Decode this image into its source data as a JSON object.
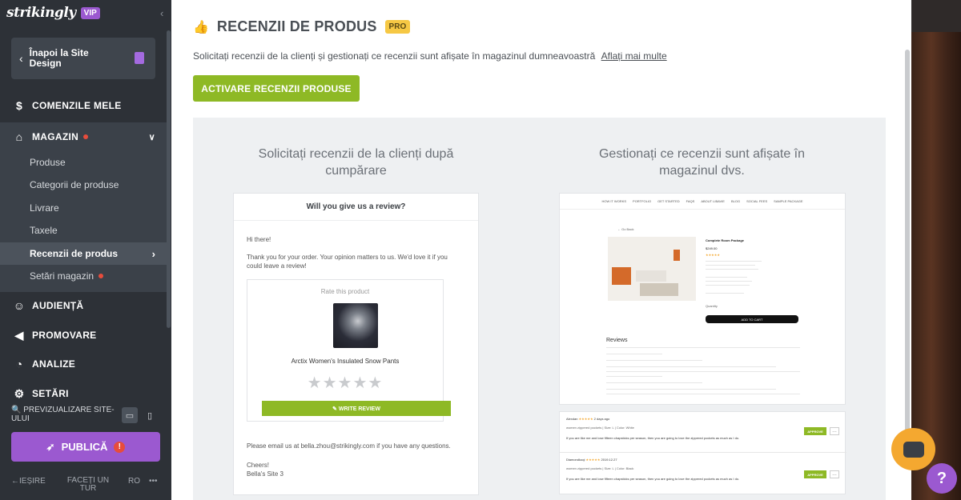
{
  "brand": {
    "logo": "strikingly",
    "badge": "VIP"
  },
  "sidebar": {
    "back_label": "Înapoi la Site Design",
    "nav": [
      {
        "label": "COMENZILE MELE",
        "icon": "dollar-circle-icon"
      },
      {
        "label": "MAGAZIN",
        "icon": "store-icon"
      },
      {
        "label": "AUDIENȚĂ",
        "icon": "audience-icon"
      },
      {
        "label": "PROMOVARE",
        "icon": "megaphone-icon"
      },
      {
        "label": "ANALIZE",
        "icon": "chart-pie-icon"
      },
      {
        "label": "SETĂRI",
        "icon": "gear-icon"
      }
    ],
    "sub": [
      "Produse",
      "Categorii de produse",
      "Livrare",
      "Taxele",
      "Recenzii de produs",
      "Setări magazin"
    ],
    "preview_label": "PREVIZUALIZARE SITE-ULUI",
    "publish_label": "PUBLICĂ",
    "publish_alert": "!",
    "footer": {
      "exit": "IEȘIRE",
      "tour": "FACEȚI UN TUR",
      "lang": "RO",
      "more": "•••"
    }
  },
  "main": {
    "title": "RECENZII DE PRODUS",
    "badge": "PRO",
    "description": "Solicitați recenzii de la clienți și gestionați ce recenzii sunt afișate în magazinul dumneavoastră",
    "learn_more": "Aflați mai multe",
    "activate_label": "ACTIVARE RECENZII PRODUSE",
    "left_title": "Solicitați recenzii de la clienți după cumpărare",
    "right_title": "Gestionați ce recenzii sunt afișate în magazinul dvs.",
    "email": {
      "heading": "Will you give us a review?",
      "greeting": "Hi there!",
      "body": "Thank you for your order. Your opinion matters to us. We'd love it if you could leave a review!",
      "rate_label": "Rate this product",
      "product": "Arctix Women's Insulated Snow Pants",
      "write_label": "✎  WRITE REVIEW",
      "footer": "Please email us at bella.zhou@strikingly.com if you have any questions.",
      "cheers": "Cheers!",
      "sign": "Bella's Site 3"
    },
    "store": {
      "nav": [
        "HOW IT WORKS",
        "PORTFOLIO",
        "GET STARTED",
        "FAQS",
        "ABOUT LIBAVIE",
        "BLOG",
        "SOCIAL FEES",
        "SAMPLE PACKAGE"
      ],
      "back": "← Go Back",
      "product": "Complete Room Package",
      "price": "$249.00",
      "reviews_title": "Reviews",
      "add_to_cart": "ADD TO CART",
      "quantity": "Quantity"
    },
    "moderation": [
      {
        "name": "Alexdan",
        "when": "2 days ago",
        "variant": "women zippered pockets  |  Size: L  |  Color: White"
      },
      {
        "name": "Diamondkoqi",
        "when": "2019.12.27",
        "variant": "women zippered pockets  |  Size: L  |  Color: Black"
      }
    ],
    "review_text": "If you are like me and lose fifteen chapsticks per season, then you are going to love the zippered pockets as much as I do.",
    "approve": "APPROVE"
  }
}
